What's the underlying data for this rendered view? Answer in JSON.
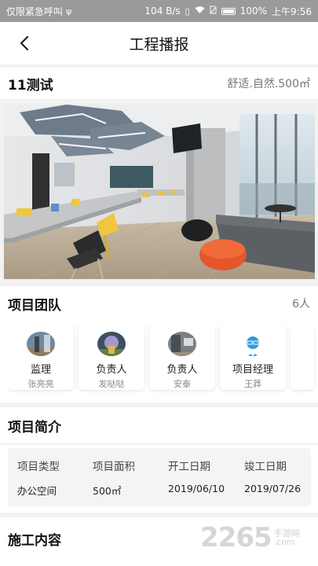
{
  "status_bar": {
    "carrier": "仅限紧急呼叫",
    "usb_icon": "usb-icon",
    "speed": "104 B/s",
    "battery": "100%",
    "time": "上午9:56"
  },
  "nav": {
    "title": "工程播报",
    "back_icon": "chevron-left-icon"
  },
  "project": {
    "name": "11测试",
    "style": "舒适.自然.500㎡"
  },
  "team": {
    "title": "项目团队",
    "count": "6人",
    "members": [
      {
        "role": "监理",
        "name": "张亮亮"
      },
      {
        "role": "负责人",
        "name": "发哒哒"
      },
      {
        "role": "负责人",
        "name": "安泰"
      },
      {
        "role": "项目经理",
        "name": "王莽"
      }
    ]
  },
  "intro": {
    "title": "项目简介",
    "fields": [
      {
        "label": "项目类型",
        "value": "办公空间"
      },
      {
        "label": "项目面积",
        "value": "500㎡"
      },
      {
        "label": "开工日期",
        "value": "2019/06/10"
      },
      {
        "label": "竣工日期",
        "value": "2019/07/26"
      }
    ]
  },
  "construction": {
    "title": "施工内容"
  },
  "watermark": {
    "number": "2265",
    "domain": ".com",
    "text": "手游网"
  },
  "colors": {
    "status_bar": "#9a9a9a",
    "background": "#f2f2f2",
    "manager_avatar": "#2f9bd6"
  }
}
